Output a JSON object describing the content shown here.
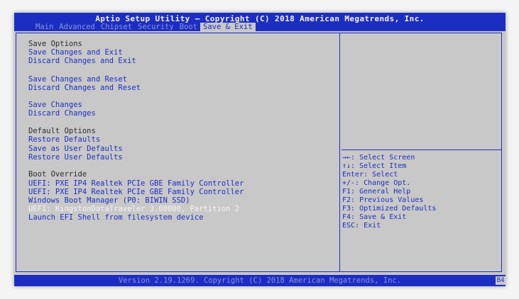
{
  "header": {
    "title": "Aptio Setup Utility – Copyright (C) 2018 American Megatrends, Inc.",
    "tabs": [
      "Main",
      "Advanced",
      "Chipset",
      "Security",
      "Boot",
      "Save & Exit"
    ],
    "active_tab": "Save & Exit"
  },
  "menu": {
    "save_options": "Save Options",
    "save_changes_and_exit": "Save Changes and Exit",
    "discard_changes_and_exit": "Discard Changes and Exit",
    "save_changes_and_reset": "Save Changes and Reset",
    "discard_changes_and_reset": "Discard Changes and Reset",
    "save_changes": "Save Changes",
    "discard_changes": "Discard Changes",
    "default_options": "Default Options",
    "restore_defaults": "Restore Defaults",
    "save_as_user_defaults": "Save as User Defaults",
    "restore_user_defaults": "Restore User Defaults",
    "boot_override": "Boot Override",
    "boot_items": [
      "UEFI: PXE IP4 Realtek PCIe GBE Family Controller",
      "UEFI: PXE IP4 Realtek PCIe GBE Family Controller",
      "Windows Boot Manager (P0: BIWIN SSD)",
      "UEFI: KingstonDataTraveler 3.00000, Partition 2"
    ],
    "selected_boot_item": 3,
    "launch_efi_shell": "Launch EFI Shell from filesystem device"
  },
  "help": {
    "lines": [
      "→←: Select Screen",
      "↑↓: Select Item",
      "Enter: Select",
      "+/-: Change Opt.",
      "F1: General Help",
      "F2: Previous Values",
      "F3: Optimized Defaults",
      "F4: Save & Exit",
      "ESC: Exit"
    ]
  },
  "footer": {
    "version": "Version 2.19.1269. Copyright (C) 2018 American Megatrends, Inc.",
    "corner": "B4"
  },
  "colors": {
    "bios_blue": "#1c2ec2",
    "panel_gray": "#c8c8c8",
    "dim_tab": "#8a94dc",
    "highlight_text": "#f4f4f4"
  }
}
